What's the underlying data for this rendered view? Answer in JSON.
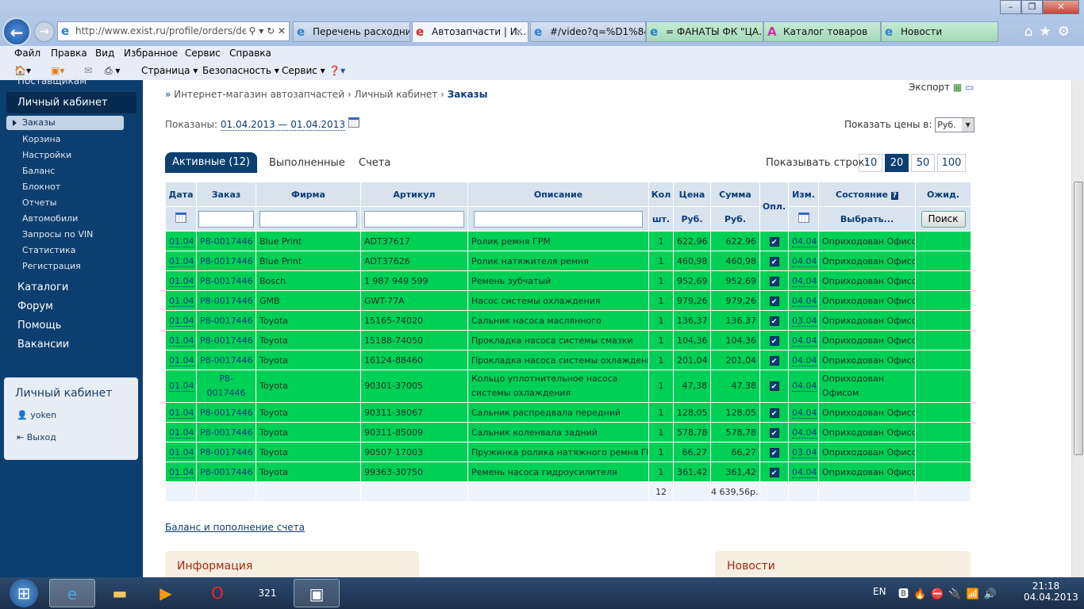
{
  "browser": {
    "url": "http://www.exist.ru/profile/orders/de",
    "tabs": [
      {
        "label": "Перечень расходни..."
      },
      {
        "label": "Автозапчасти | И..."
      },
      {
        "label": "#/video?q=%D1%84..."
      },
      {
        "label": "= ФАНАТЫ ФК \"ЦА..."
      },
      {
        "label": "Каталог товаров"
      },
      {
        "label": "Новости"
      }
    ],
    "menu": [
      "Файл",
      "Правка",
      "Вид",
      "Избранное",
      "Сервис",
      "Справка"
    ],
    "commands": [
      "Страница ▾",
      "Безопасность ▾",
      "Сервис ▾"
    ]
  },
  "sidebar": {
    "top_partial": "Поставщикам",
    "section": "Личный кабинет",
    "items": [
      "Заказы",
      "Корзина",
      "Настройки",
      "Баланс",
      "Блокнот",
      "Отчеты",
      "Автомобили",
      "Запросы по VIN",
      "Статистика",
      "Регистрация"
    ],
    "main_links": [
      "Каталоги",
      "Форум",
      "Помощь",
      "Вакансии"
    ],
    "cabinet_box": {
      "title": "Личный кабинет",
      "user": "yoken",
      "logout": "Выход"
    }
  },
  "page": {
    "export": "Экспорт",
    "breadcrumb": [
      "Интернет-магазин автозапчастей",
      "Личный кабинет",
      "Заказы"
    ],
    "shown_label": "Показаны:",
    "shown_range": "01.04.2013 — 01.04.2013",
    "prices_label": "Показать цены в:",
    "currency": "Руб.",
    "tabs": [
      "Активные (12)",
      "Выполненные",
      "Счета"
    ],
    "rows_label": "Показывать строк:",
    "page_sizes": [
      "10",
      "20",
      "50",
      "100"
    ],
    "selected_page_size": "20",
    "balance_link": "Баланс и пополнение счета",
    "info_title": "Информация",
    "news_title": "Новости"
  },
  "table": {
    "headers": {
      "date": "Дата",
      "order": "Заказ",
      "firm": "Фирма",
      "article": "Артикул",
      "desc": "Описание",
      "qty": "Кол",
      "price": "Цена",
      "sum": "Сумма",
      "paid": "Опл.",
      "changed": "Изм.",
      "status": "Состояние",
      "wait": "Ожид."
    },
    "subheaders": {
      "qty": "шт.",
      "price": "Руб.",
      "sum": "Руб.",
      "status": "Выбрать...",
      "search": "Поиск"
    },
    "rows": [
      {
        "date": "01.04",
        "order": "P8-0017446",
        "firm": "Blue Print",
        "article": "ADT37617",
        "desc": "Ролик ремня ГРМ",
        "qty": "1",
        "price": "622,96",
        "sum": "622,96",
        "changed": "04.04",
        "status": "Оприходован Офисом"
      },
      {
        "date": "01.04",
        "order": "P8-0017446",
        "firm": "Blue Print",
        "article": "ADT37626",
        "desc": "Ролик натяжителя ремня",
        "qty": "1",
        "price": "460,98",
        "sum": "460,98",
        "changed": "04.04",
        "status": "Оприходован Офисом"
      },
      {
        "date": "01.04",
        "order": "P8-0017446",
        "firm": "Bosch",
        "article": "1 987 949 599",
        "desc": "Ремень зубчатый",
        "qty": "1",
        "price": "952,69",
        "sum": "952,69",
        "changed": "04.04",
        "status": "Оприходован Офисом"
      },
      {
        "date": "01.04",
        "order": "P8-0017446",
        "firm": "GMB",
        "article": "GWT-77A",
        "desc": "Насос системы охлаждения",
        "qty": "1",
        "price": "979,26",
        "sum": "979,26",
        "changed": "04.04",
        "status": "Оприходован Офисом"
      },
      {
        "date": "01.04",
        "order": "P8-0017446",
        "firm": "Toyota",
        "article": "15165-74020",
        "desc": "Сальник насоса маслянного",
        "qty": "1",
        "price": "136,37",
        "sum": "136,37",
        "changed": "03.04",
        "status": "Оприходован Офисом"
      },
      {
        "date": "01.04",
        "order": "P8-0017446",
        "firm": "Toyota",
        "article": "15188-74050",
        "desc": "Прокладка насоса системы смазки",
        "qty": "1",
        "price": "104,36",
        "sum": "104,36",
        "changed": "04.04",
        "status": "Оприходован Офисом"
      },
      {
        "date": "01.04",
        "order": "P8-0017446",
        "firm": "Toyota",
        "article": "16124-88460",
        "desc": "Прокладка насоса системы охлаждения",
        "qty": "1",
        "price": "201,04",
        "sum": "201,04",
        "changed": "04.04",
        "status": "Оприходован Офисом"
      },
      {
        "date": "01.04",
        "order": "P8-0017446",
        "firm": "Toyota",
        "article": "90301-37005",
        "desc": "Кольцо уплотнительное насоса системы охлаждения",
        "qty": "1",
        "price": "47,38",
        "sum": "47,38",
        "changed": "04.04",
        "status": "Оприходован Офисом"
      },
      {
        "date": "01.04",
        "order": "P8-0017446",
        "firm": "Toyota",
        "article": "90311-38067",
        "desc": "Сальник распредвала передний",
        "qty": "1",
        "price": "128,05",
        "sum": "128,05",
        "changed": "04.04",
        "status": "Оприходован Офисом"
      },
      {
        "date": "01.04",
        "order": "P8-0017446",
        "firm": "Toyota",
        "article": "90311-85009",
        "desc": "Сальник коленвала задний",
        "qty": "1",
        "price": "578,78",
        "sum": "578,78",
        "changed": "04.04",
        "status": "Оприходован Офисом"
      },
      {
        "date": "01.04",
        "order": "P8-0017446",
        "firm": "Toyota",
        "article": "90507-17003",
        "desc": "Пружинка ролика натяжного ремня ГРМ",
        "qty": "1",
        "price": "66,27",
        "sum": "66,27",
        "changed": "03.04",
        "status": "Оприходован Офисом"
      },
      {
        "date": "01.04",
        "order": "P8-0017446",
        "firm": "Toyota",
        "article": "99363-30750",
        "desc": "Ремень насоса гидроусилителя",
        "qty": "1",
        "price": "361,42",
        "sum": "361,42",
        "changed": "04.04",
        "status": "Оприходован Офисом"
      }
    ],
    "total_qty": "12",
    "total_sum": "4 639,56р."
  },
  "taskbar": {
    "lang": "EN",
    "time": "21:18",
    "date": "04.04.2013"
  }
}
